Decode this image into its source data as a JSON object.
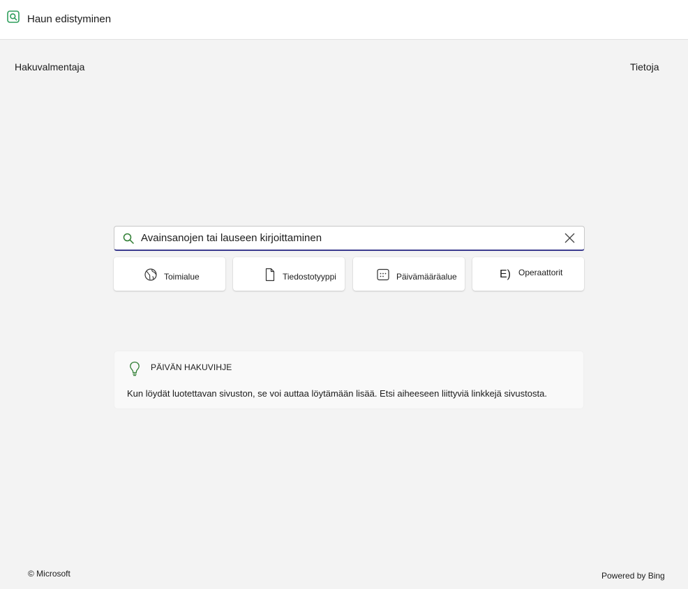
{
  "app": {
    "title": "Haun edistyminen",
    "icon": "search-app-icon",
    "accent_color": "#2e9e5b"
  },
  "nav": {
    "left_link": "Hakuvalmentaja",
    "right_link": "Tietoja"
  },
  "search": {
    "placeholder": "Avainsanojen tai lauseen kirjoittaminen",
    "value": "",
    "underline_color": "#3b3b8f"
  },
  "filters": [
    {
      "label": "Toimialue",
      "icon": "globe-icon"
    },
    {
      "label": "Tiedostotyyppi",
      "icon": "document-icon"
    },
    {
      "label": "Päivämääräalue",
      "icon": "calendar-icon"
    },
    {
      "label": "Operaattorit",
      "icon_text": "E)"
    }
  ],
  "tip": {
    "heading": "PÄIVÄN HAKUVIHJE",
    "text": "Kun löydät luotettavan sivuston, se voi auttaa löytämään lisää. Etsi aiheeseen liittyviä linkkejä sivustosta.",
    "icon": "lightbulb-icon",
    "icon_color": "#2e7d32"
  },
  "footer": {
    "copyright": "© Microsoft",
    "powered_by": "Powered by Bing"
  }
}
